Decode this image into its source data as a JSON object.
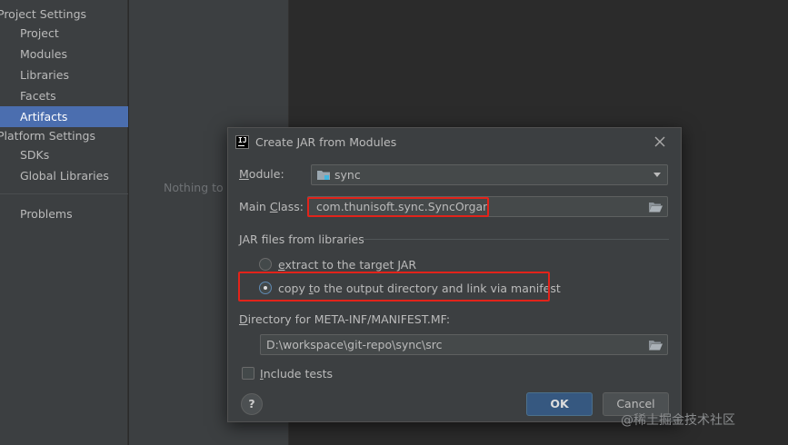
{
  "sidebar": {
    "project_settings": "Project Settings",
    "project_items": [
      "Project",
      "Modules",
      "Libraries",
      "Facets",
      "Artifacts"
    ],
    "platform_settings": "Platform Settings",
    "platform_items": [
      "SDKs",
      "Global Libraries"
    ],
    "problems": "Problems",
    "selected": "Artifacts"
  },
  "middle": {
    "empty_text": "Nothing to s"
  },
  "dialog": {
    "title": "Create JAR from Modules",
    "module_label_mnemonic": "M",
    "module_label_rest": "odule:",
    "module_value": "sync",
    "main_class_label_prefix": "Main ",
    "main_class_label_mnemonic": "C",
    "main_class_label_rest": "lass:",
    "main_class_value": "com.thunisoft.sync.SyncOrgan",
    "group_title": "JAR files from libraries",
    "option_extract_mnemonic": "e",
    "option_extract_rest": "xtract to the target JAR",
    "option_copy_prefix": "copy ",
    "option_copy_mnemonic": "t",
    "option_copy_rest": "o the output directory and link via manifest",
    "selected_option": "copy",
    "manifest_dir_label_mnemonic": "D",
    "manifest_dir_label_rest": "irectory for META-INF/MANIFEST.MF:",
    "manifest_dir_value": "D:\\workspace\\git-repo\\sync\\src",
    "include_tests_mnemonic": "I",
    "include_tests_rest": "nclude tests",
    "include_tests_checked": false,
    "help_label": "?",
    "ok_label": "OK",
    "cancel_label": "Cancel"
  },
  "watermark": "@稀土掘金技术社区",
  "colors": {
    "selection": "#4b6eaf",
    "highlight_box": "#e2231a",
    "ok_button": "#365880"
  }
}
